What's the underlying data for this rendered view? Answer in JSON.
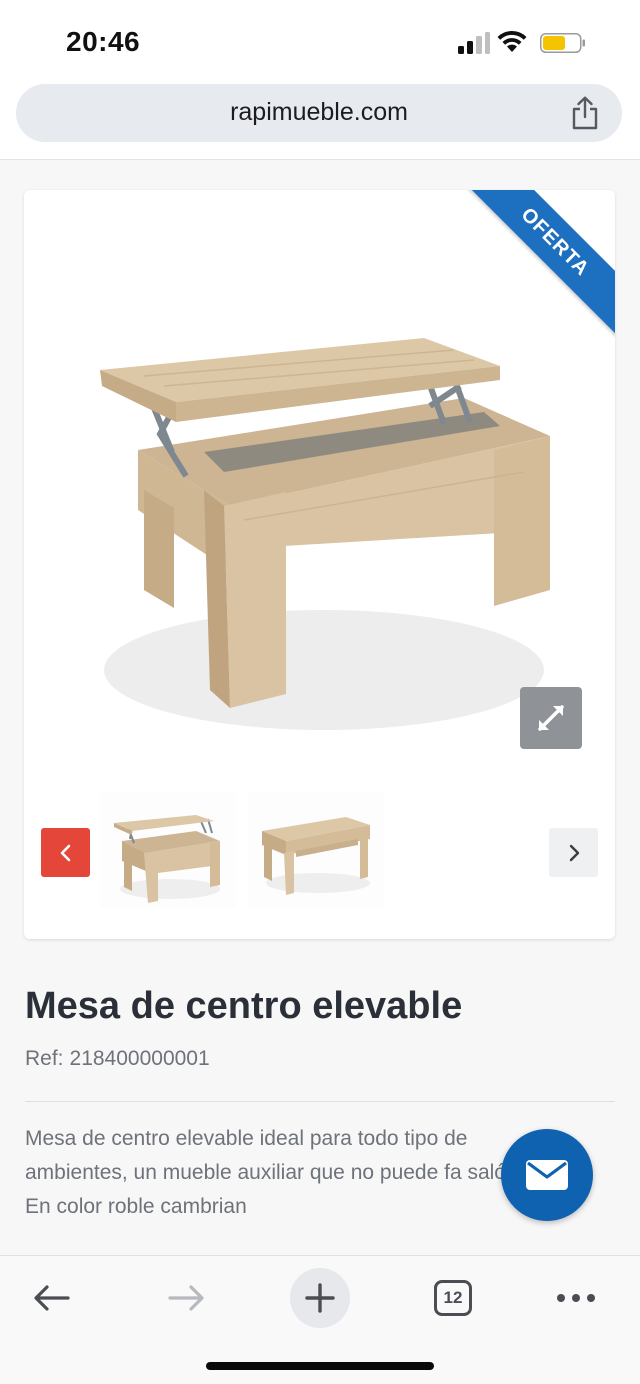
{
  "status_bar": {
    "time": "20:46",
    "icons": [
      "signal-icon",
      "wifi-icon",
      "battery-icon"
    ],
    "battery_color": "#f5c400"
  },
  "browser": {
    "url": "rapimueble.com",
    "share_icon": "share-icon"
  },
  "product": {
    "badge": "OFERTA",
    "badge_color": "#1d6fc0",
    "main_image_alt": "coffee-table-lift-top",
    "thumbnails": [
      "lift-top-open",
      "lift-top-closed"
    ],
    "title": "Mesa de centro elevable",
    "ref_label": "Ref:",
    "ref_value": "218400000001",
    "description": "Mesa de centro elevable ideal para todo tipo de ambientes, un mueble auxiliar que no puede fa salón. En color roble cambrian"
  },
  "contact": {
    "icon": "mail-icon",
    "color": "#0f62b0"
  },
  "toolbar": {
    "tab_count": "12",
    "buttons": [
      "back-arrow-icon",
      "forward-arrow-icon",
      "plus-icon",
      "tabs-icon",
      "more-icon"
    ]
  },
  "colors": {
    "accent_red": "#e4473a",
    "wood": "#d9c3a2"
  }
}
